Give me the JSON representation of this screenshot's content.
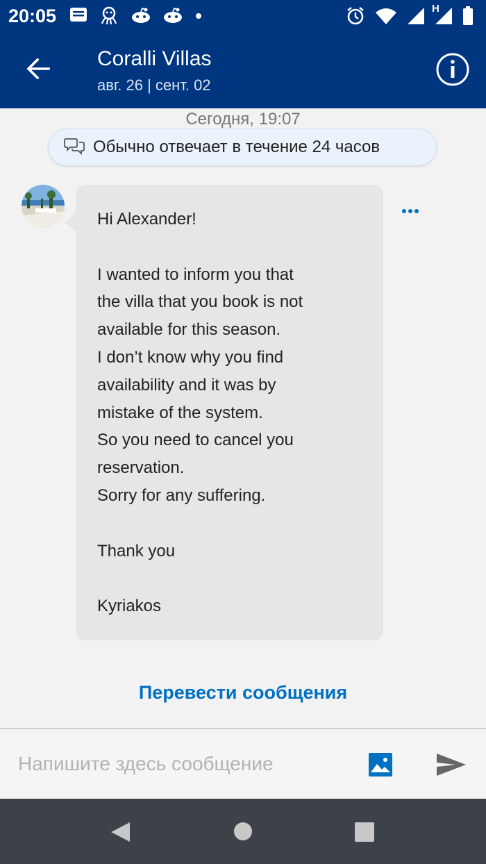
{
  "status_bar": {
    "time": "20:05",
    "network_label": "H",
    "icons_left": [
      "message-icon",
      "octopus-icon",
      "reddit-icon",
      "reddit-icon",
      "dot-icon"
    ],
    "icons_right": [
      "alarm-icon",
      "wifi-icon",
      "signal-icon",
      "signal-icon",
      "battery-icon"
    ]
  },
  "header": {
    "title": "Coralli Villas",
    "dates": "авг. 26 | сент. 02"
  },
  "conversation": {
    "date_stamp": "Сегодня, 19:07",
    "response_time": "Обычно отвечает в течение 24 часов",
    "message": {
      "text": "Hi Alexander!\n\nI wanted to inform you that\nthe villa that you book is not\navailable for this season.\nI don’t know why you find\navailability and it was by\nmistake of the system.\nSo you need to cancel you\nreservation.\nSorry for any suffering.\n\nThank you\n\nKyriakos"
    },
    "translate_label": "Перевести сообщения"
  },
  "composer": {
    "placeholder": "Напишите здесь сообщение",
    "value": ""
  },
  "colors": {
    "brand_blue": "#003580",
    "link_blue": "#0071c2",
    "bubble_gray": "#e6e6e6",
    "nav_bar": "#3d4148"
  }
}
